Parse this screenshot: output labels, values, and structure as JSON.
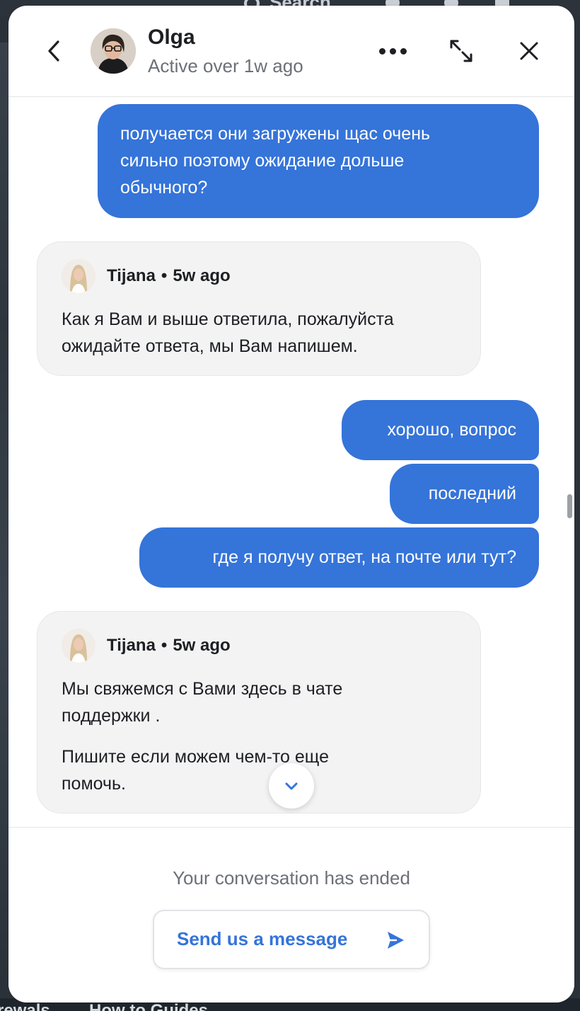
{
  "background": {
    "search_label": "Search",
    "footer_links": [
      "rewals",
      "How to Guides"
    ]
  },
  "header": {
    "agent_name": "Olga",
    "agent_status": "Active over 1w ago"
  },
  "messages": [
    {
      "from": "user",
      "text_lines": [
        "получается они загружены щас очень",
        "сильно поэтому ожидание дольше",
        "обычного?"
      ]
    },
    {
      "from": "agent",
      "author": "Tijana",
      "separator": "•",
      "time": "5w ago",
      "paragraphs": [
        [
          "Как я Вам и выше ответила, пожалуйста",
          "ожидайте ответа, мы Вам напишем."
        ]
      ]
    },
    {
      "from": "user",
      "text_lines": [
        "хорошо, вопрос"
      ]
    },
    {
      "from": "user",
      "text_lines": [
        "последний"
      ]
    },
    {
      "from": "user",
      "text_lines": [
        "где я получу ответ, на почте или тут?"
      ]
    },
    {
      "from": "agent",
      "author": "Tijana",
      "separator": "•",
      "time": "5w ago",
      "paragraphs": [
        [
          "Мы свяжемся с Вами здесь в чате",
          "поддержки ."
        ],
        [
          "Пишите если можем чем-то еще",
          "помочь."
        ]
      ]
    }
  ],
  "footer": {
    "ended_text": "Your conversation has ended",
    "send_label": "Send us a message"
  },
  "colors": {
    "accent": "#3574d9",
    "agent_bubble": "#f3f3f4",
    "text": "#1d1f23",
    "muted": "#6c7078"
  },
  "icons": {
    "back": "chevron-left-icon",
    "more": "more-horizontal-icon",
    "expand": "expand-icon",
    "close": "close-icon",
    "scroll_down": "chevron-down-icon",
    "send": "send-arrow-icon"
  }
}
